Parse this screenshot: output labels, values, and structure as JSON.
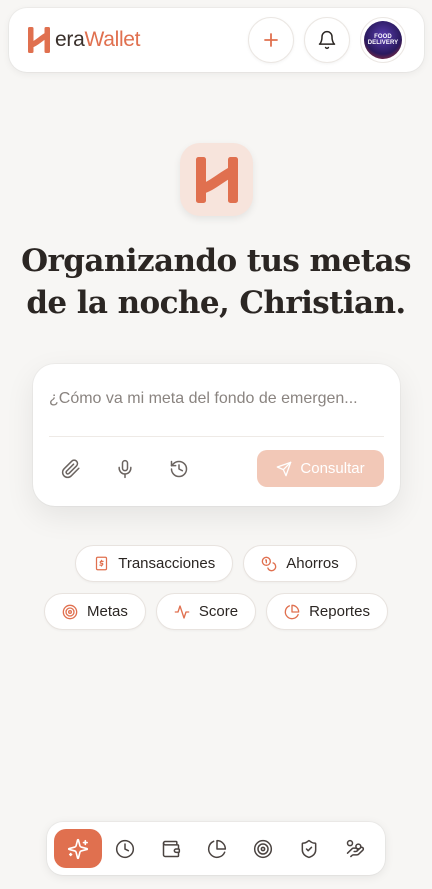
{
  "app": {
    "brand_dark": "era",
    "brand_accent": "Wallet",
    "accent_color": "#e0704f"
  },
  "header": {
    "add_icon": "plus-icon",
    "notifications_icon": "bell-icon",
    "avatar": {
      "line1": "FOOD",
      "line2": "DELIVERY",
      "line3": ""
    }
  },
  "hero": {
    "greeting_line1": "Organizando tus metas",
    "greeting_line2": "de la noche, Christian."
  },
  "query": {
    "placeholder": "¿Cómo va mi meta del fondo de emergen...",
    "value": "",
    "submit_label": "Consultar",
    "tools": [
      "paperclip-icon",
      "microphone-icon",
      "history-icon"
    ]
  },
  "quick_actions": {
    "row1": [
      {
        "label": "Transacciones",
        "icon": "receipt-dollar-icon"
      },
      {
        "label": "Ahorros",
        "icon": "coins-icon"
      }
    ],
    "row2": [
      {
        "label": "Metas",
        "icon": "target-icon"
      },
      {
        "label": "Score",
        "icon": "activity-icon"
      },
      {
        "label": "Reportes",
        "icon": "pie-chart-icon"
      }
    ]
  },
  "bottom_nav": {
    "items": [
      {
        "icon": "sparkles-icon",
        "active": true
      },
      {
        "icon": "clock-icon",
        "active": false
      },
      {
        "icon": "wallet-icon",
        "active": false
      },
      {
        "icon": "pie-chart-icon",
        "active": false
      },
      {
        "icon": "target-icon",
        "active": false
      },
      {
        "icon": "shield-icon",
        "active": false
      },
      {
        "icon": "hand-coins-icon",
        "active": false
      }
    ]
  }
}
